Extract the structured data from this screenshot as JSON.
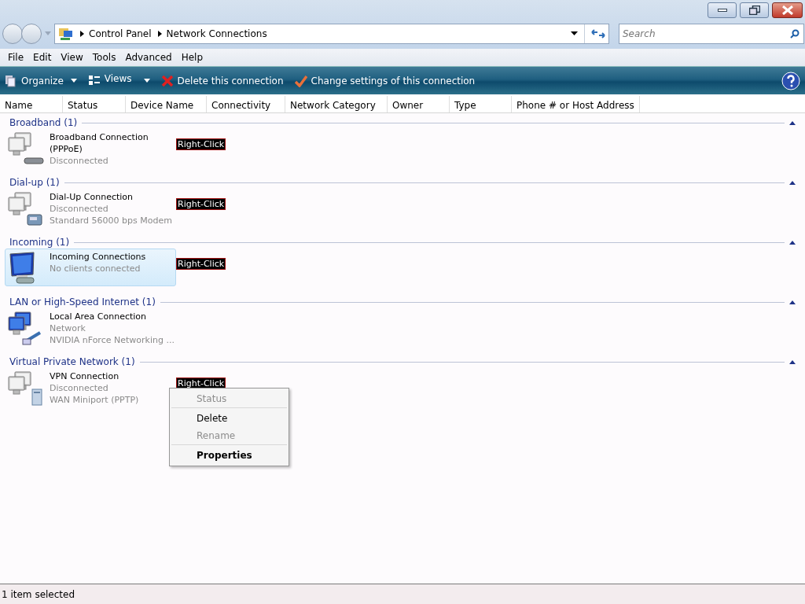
{
  "address": {
    "path": [
      "Control Panel",
      "Network Connections"
    ],
    "search_placeholder": "Search"
  },
  "menu": [
    "File",
    "Edit",
    "View",
    "Tools",
    "Advanced",
    "Help"
  ],
  "toolbar": [
    {
      "label": "Organize",
      "kind": "organize",
      "dropdown": true
    },
    {
      "label": "Views",
      "kind": "views",
      "dropdown": true
    },
    {
      "label": "Delete this connection",
      "kind": "delete",
      "dropdown": false
    },
    {
      "label": "Change settings of this connection",
      "kind": "settings",
      "dropdown": false
    }
  ],
  "columns": [
    "Name",
    "Status",
    "Device Name",
    "Connectivity",
    "Network Category",
    "Owner",
    "Type",
    "Phone # or Host Address"
  ],
  "groups": [
    {
      "title": "Broadband (1)",
      "items": [
        {
          "kind": "broadband",
          "name": "Broadband Connection (PPPoE)",
          "details": [
            "Disconnected"
          ],
          "selected": false,
          "annotation": "Right-Click"
        }
      ]
    },
    {
      "title": "Dial-up (1)",
      "items": [
        {
          "kind": "dialup",
          "name": "Dial-Up Connection",
          "details": [
            "Disconnected",
            "Standard 56000 bps Modem"
          ],
          "selected": false,
          "annotation": "Right-Click"
        }
      ]
    },
    {
      "title": "Incoming (1)",
      "items": [
        {
          "kind": "incoming",
          "name": "Incoming Connections",
          "details": [
            "No clients connected"
          ],
          "selected": true,
          "annotation": "Right-Click"
        }
      ]
    },
    {
      "title": "LAN or High-Speed Internet (1)",
      "items": [
        {
          "kind": "lan",
          "name": "Local Area Connection",
          "details": [
            "Network",
            "NVIDIA nForce Networking ..."
          ],
          "selected": false
        }
      ]
    },
    {
      "title": "Virtual Private Network (1)",
      "items": [
        {
          "kind": "vpn",
          "name": "VPN Connection",
          "details": [
            "Disconnected",
            "WAN Miniport (PPTP)"
          ],
          "selected": false,
          "annotation": "Right-Click"
        }
      ]
    }
  ],
  "context_menu": [
    {
      "label": "Status",
      "disabled": true,
      "default": false,
      "separator_after": true
    },
    {
      "label": "Delete",
      "disabled": false,
      "default": false,
      "separator_after": false
    },
    {
      "label": "Rename",
      "disabled": true,
      "default": false,
      "separator_after": true
    },
    {
      "label": "Properties",
      "disabled": false,
      "default": true,
      "separator_after": false
    }
  ],
  "status_bar": "1 item selected"
}
